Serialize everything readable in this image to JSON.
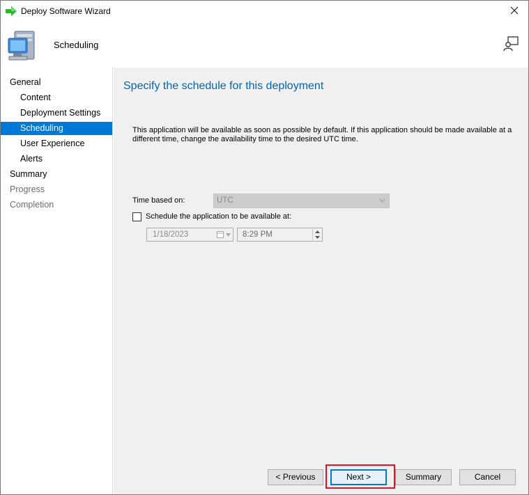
{
  "window": {
    "title": "Deploy Software Wizard"
  },
  "header": {
    "page_name": "Scheduling"
  },
  "nav": {
    "items": [
      {
        "label": "General",
        "level": "top",
        "state": "normal"
      },
      {
        "label": "Content",
        "level": "sub",
        "state": "normal"
      },
      {
        "label": "Deployment Settings",
        "level": "sub",
        "state": "normal"
      },
      {
        "label": "Scheduling",
        "level": "sub",
        "state": "active"
      },
      {
        "label": "User Experience",
        "level": "sub",
        "state": "normal"
      },
      {
        "label": "Alerts",
        "level": "sub",
        "state": "normal"
      },
      {
        "label": "Summary",
        "level": "top",
        "state": "normal"
      },
      {
        "label": "Progress",
        "level": "top",
        "state": "disabled"
      },
      {
        "label": "Completion",
        "level": "top",
        "state": "disabled"
      }
    ]
  },
  "main": {
    "heading": "Specify the schedule for this deployment",
    "description": "This application will be available as soon as possible by default. If this application should be made available at a different time, change the availability time to the desired UTC time.",
    "time_based_on": {
      "label": "Time based on:",
      "value": "UTC",
      "enabled": false
    },
    "schedule_checkbox": {
      "label": "Schedule the application to be available at:",
      "checked": false
    },
    "date": {
      "value": "1/18/2023",
      "enabled": false
    },
    "time": {
      "value": "8:29 PM",
      "enabled": false
    }
  },
  "buttons": {
    "previous": "< Previous",
    "next": "Next >",
    "summary": "Summary",
    "cancel": "Cancel"
  },
  "colors": {
    "accent": "#0078d7",
    "heading": "#0066b8",
    "highlight": "#e81123",
    "content_bg": "#f0f0f0"
  },
  "icons": {
    "title": "green-arrow-icon",
    "header": "computer-icon",
    "help": "help-person-icon",
    "close": "close-icon"
  }
}
